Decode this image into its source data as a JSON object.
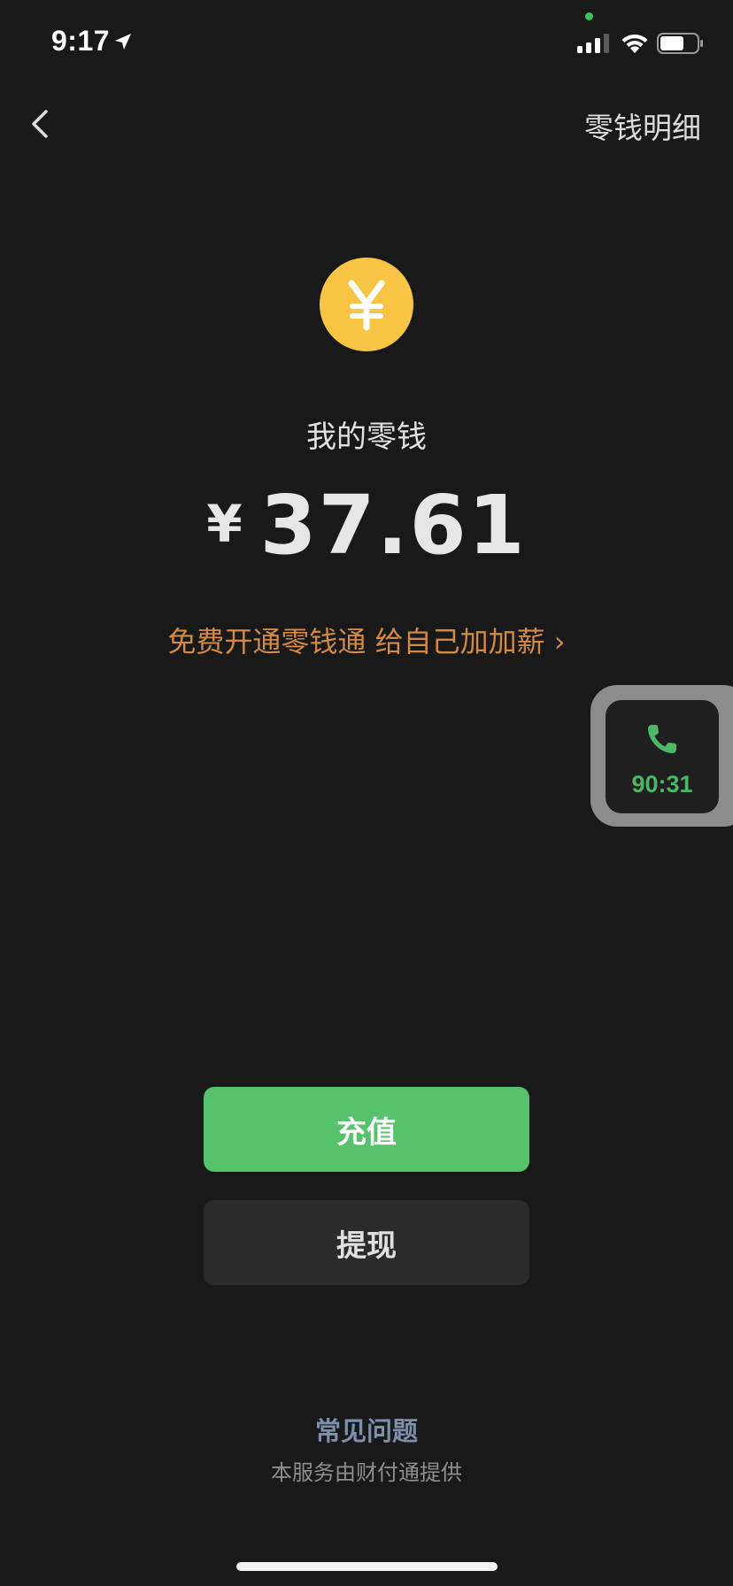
{
  "status_bar": {
    "time": "9:17"
  },
  "nav": {
    "right_label": "零钱明细"
  },
  "wallet": {
    "coin_symbol": "¥",
    "label": "我的零钱",
    "currency": "¥",
    "amount": "37.61"
  },
  "promo": {
    "text": "免费开通零钱通 给自己加加薪 ›"
  },
  "call_widget": {
    "timer": "90:31"
  },
  "buttons": {
    "recharge": "充值",
    "withdraw": "提现"
  },
  "footer": {
    "faq": "常见问题",
    "provider": "本服务由财付通提供"
  },
  "colors": {
    "background": "#191919",
    "coin": "#f8c443",
    "primary_button": "#57c26c",
    "secondary_button": "#2b2b2b",
    "promo_link": "#d28a45",
    "faq_link": "#7d8fab",
    "call_green": "#4cb865"
  },
  "icons": {
    "back": "chevron-left-icon",
    "location": "location-arrow-icon",
    "signal": "cellular-signal-icon",
    "wifi": "wifi-icon",
    "battery": "battery-icon",
    "phone": "phone-icon",
    "coin": "yuan-coin-icon"
  }
}
